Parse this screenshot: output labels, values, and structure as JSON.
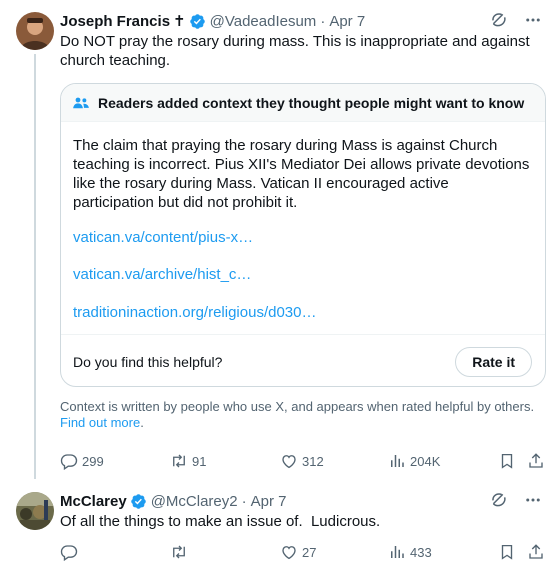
{
  "tweet1": {
    "display_name": "Joseph Francis",
    "name_glyph": "✝",
    "handle": "@VadeadIesum",
    "separator": "·",
    "date": "Apr 7",
    "text": "Do NOT pray the rosary during mass. This is inappropriate and against church teaching.",
    "community_note": {
      "header": "Readers added context they thought people might want to know",
      "body": "The claim that praying the rosary during Mass is against Church teaching is incorrect. Pius XII's Mediator Dei allows private devotions like the rosary during Mass. Vatican II encouraged active participation but did not prohibit it.",
      "links": [
        "vatican.va/content/pius-x…",
        "vatican.va/archive/hist_c…",
        "traditioninaction.org/religious/d030…"
      ],
      "helpful_question": "Do you find this helpful?",
      "rate_button": "Rate it"
    },
    "context_text": "Context is written by people who use X, and appears when rated helpful by others.",
    "find_out_more": "Find out more",
    "context_end": ".",
    "metrics": {
      "replies": "299",
      "reposts": "91",
      "likes": "312",
      "views": "204K"
    }
  },
  "tweet2": {
    "display_name": "McClarey",
    "handle": "@McClarey2",
    "separator": "·",
    "date": "Apr 7",
    "text": "Of all the things to make an issue of.  Ludicrous.",
    "metrics": {
      "replies": "",
      "reposts": "",
      "likes": "27",
      "views": "433"
    }
  },
  "colors": {
    "accent": "#1d9bf0",
    "text_primary": "#0f1419",
    "text_secondary": "#536471",
    "border": "#cfd9de"
  },
  "icons": [
    "grok-icon",
    "more-icon",
    "verified-badge-icon",
    "people-icon",
    "reply-icon",
    "repost-icon",
    "like-icon",
    "views-icon",
    "bookmark-icon",
    "share-icon"
  ]
}
